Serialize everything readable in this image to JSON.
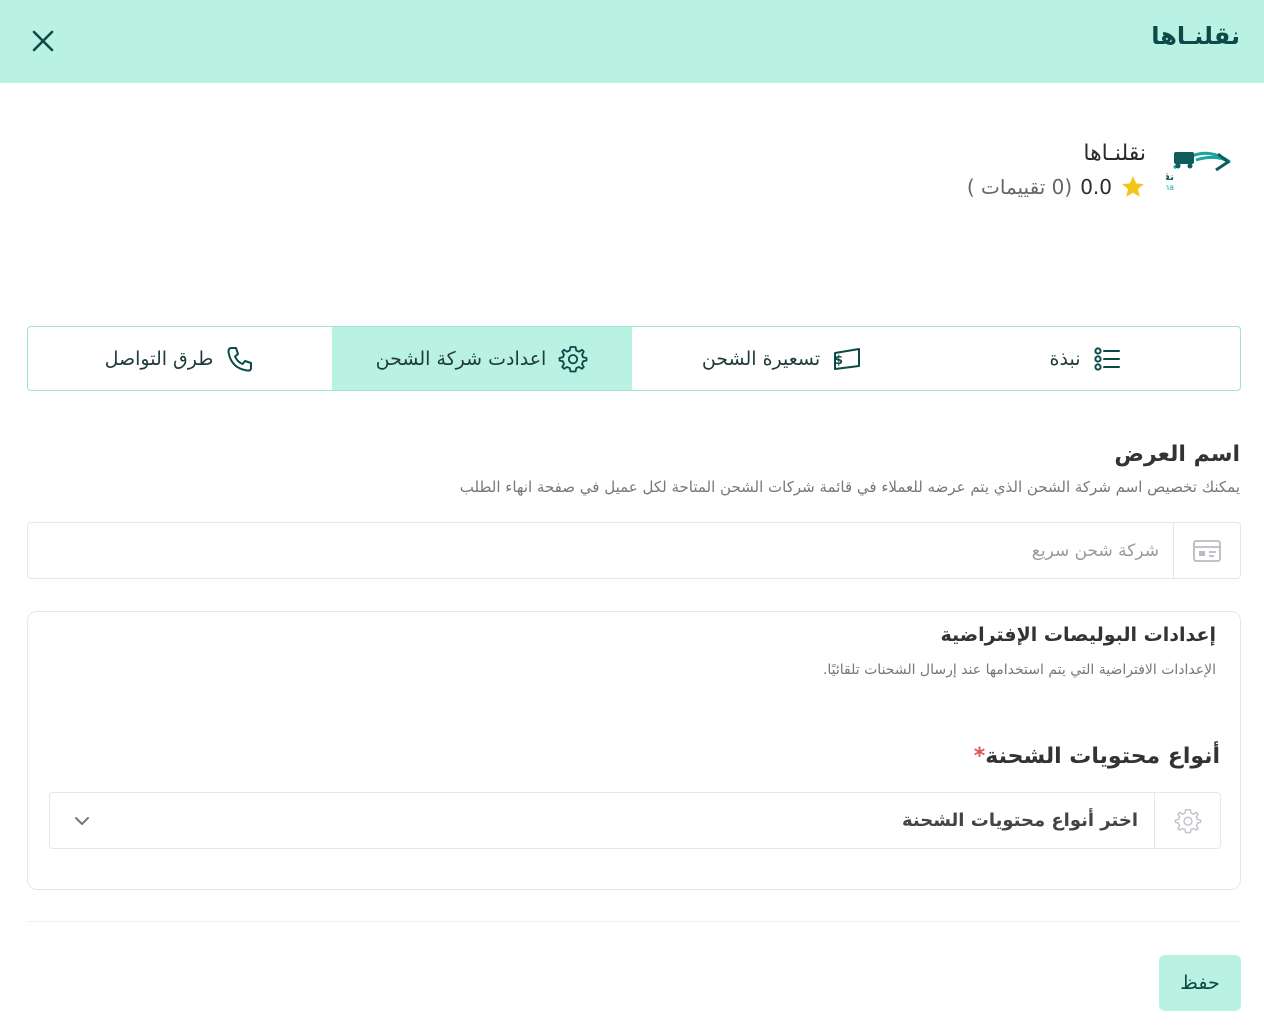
{
  "header": {
    "title": "نقلنـاها"
  },
  "company": {
    "name": "نقلنـاها",
    "rating_value": "0.0",
    "rating_count": "(0 تقييمات )",
    "logo_text": "نقلناها",
    "logo_subtext": "Naqlnaha"
  },
  "tabs": [
    {
      "label": "نبذة",
      "icon": "list-icon",
      "active": false
    },
    {
      "label": "تسعيرة الشحن",
      "icon": "money-icon",
      "active": false
    },
    {
      "label": "اعدادت شركة الشحن",
      "icon": "gear-icon",
      "active": true
    },
    {
      "label": "طرق التواصل",
      "icon": "phone-icon",
      "active": false
    }
  ],
  "display_name": {
    "title": "اسم العرض",
    "description": "يمكنك تخصيص اسم شركة الشحن الذي يتم عرضه للعملاء في قائمة شركات الشحن المتاحة لكل عميل في صفحة انهاء الطلب",
    "placeholder": "شركة شحن سريع",
    "value": ""
  },
  "policy": {
    "title": "إعدادات البوليصات الإفتراضية",
    "description": "الإعدادات الافتراضية التي يتم استخدامها عند إرسال الشحنات تلقائيًا.",
    "contents_label": "أنواع محتويات الشحنة",
    "required_mark": "*",
    "select_placeholder": "اختر أنواع محتويات الشحنة"
  },
  "actions": {
    "save_label": "حفظ"
  },
  "colors": {
    "accent": "#b9f1e3",
    "accent_dark": "#0b4a47",
    "star": "#f5c518",
    "required": "#e05252"
  }
}
